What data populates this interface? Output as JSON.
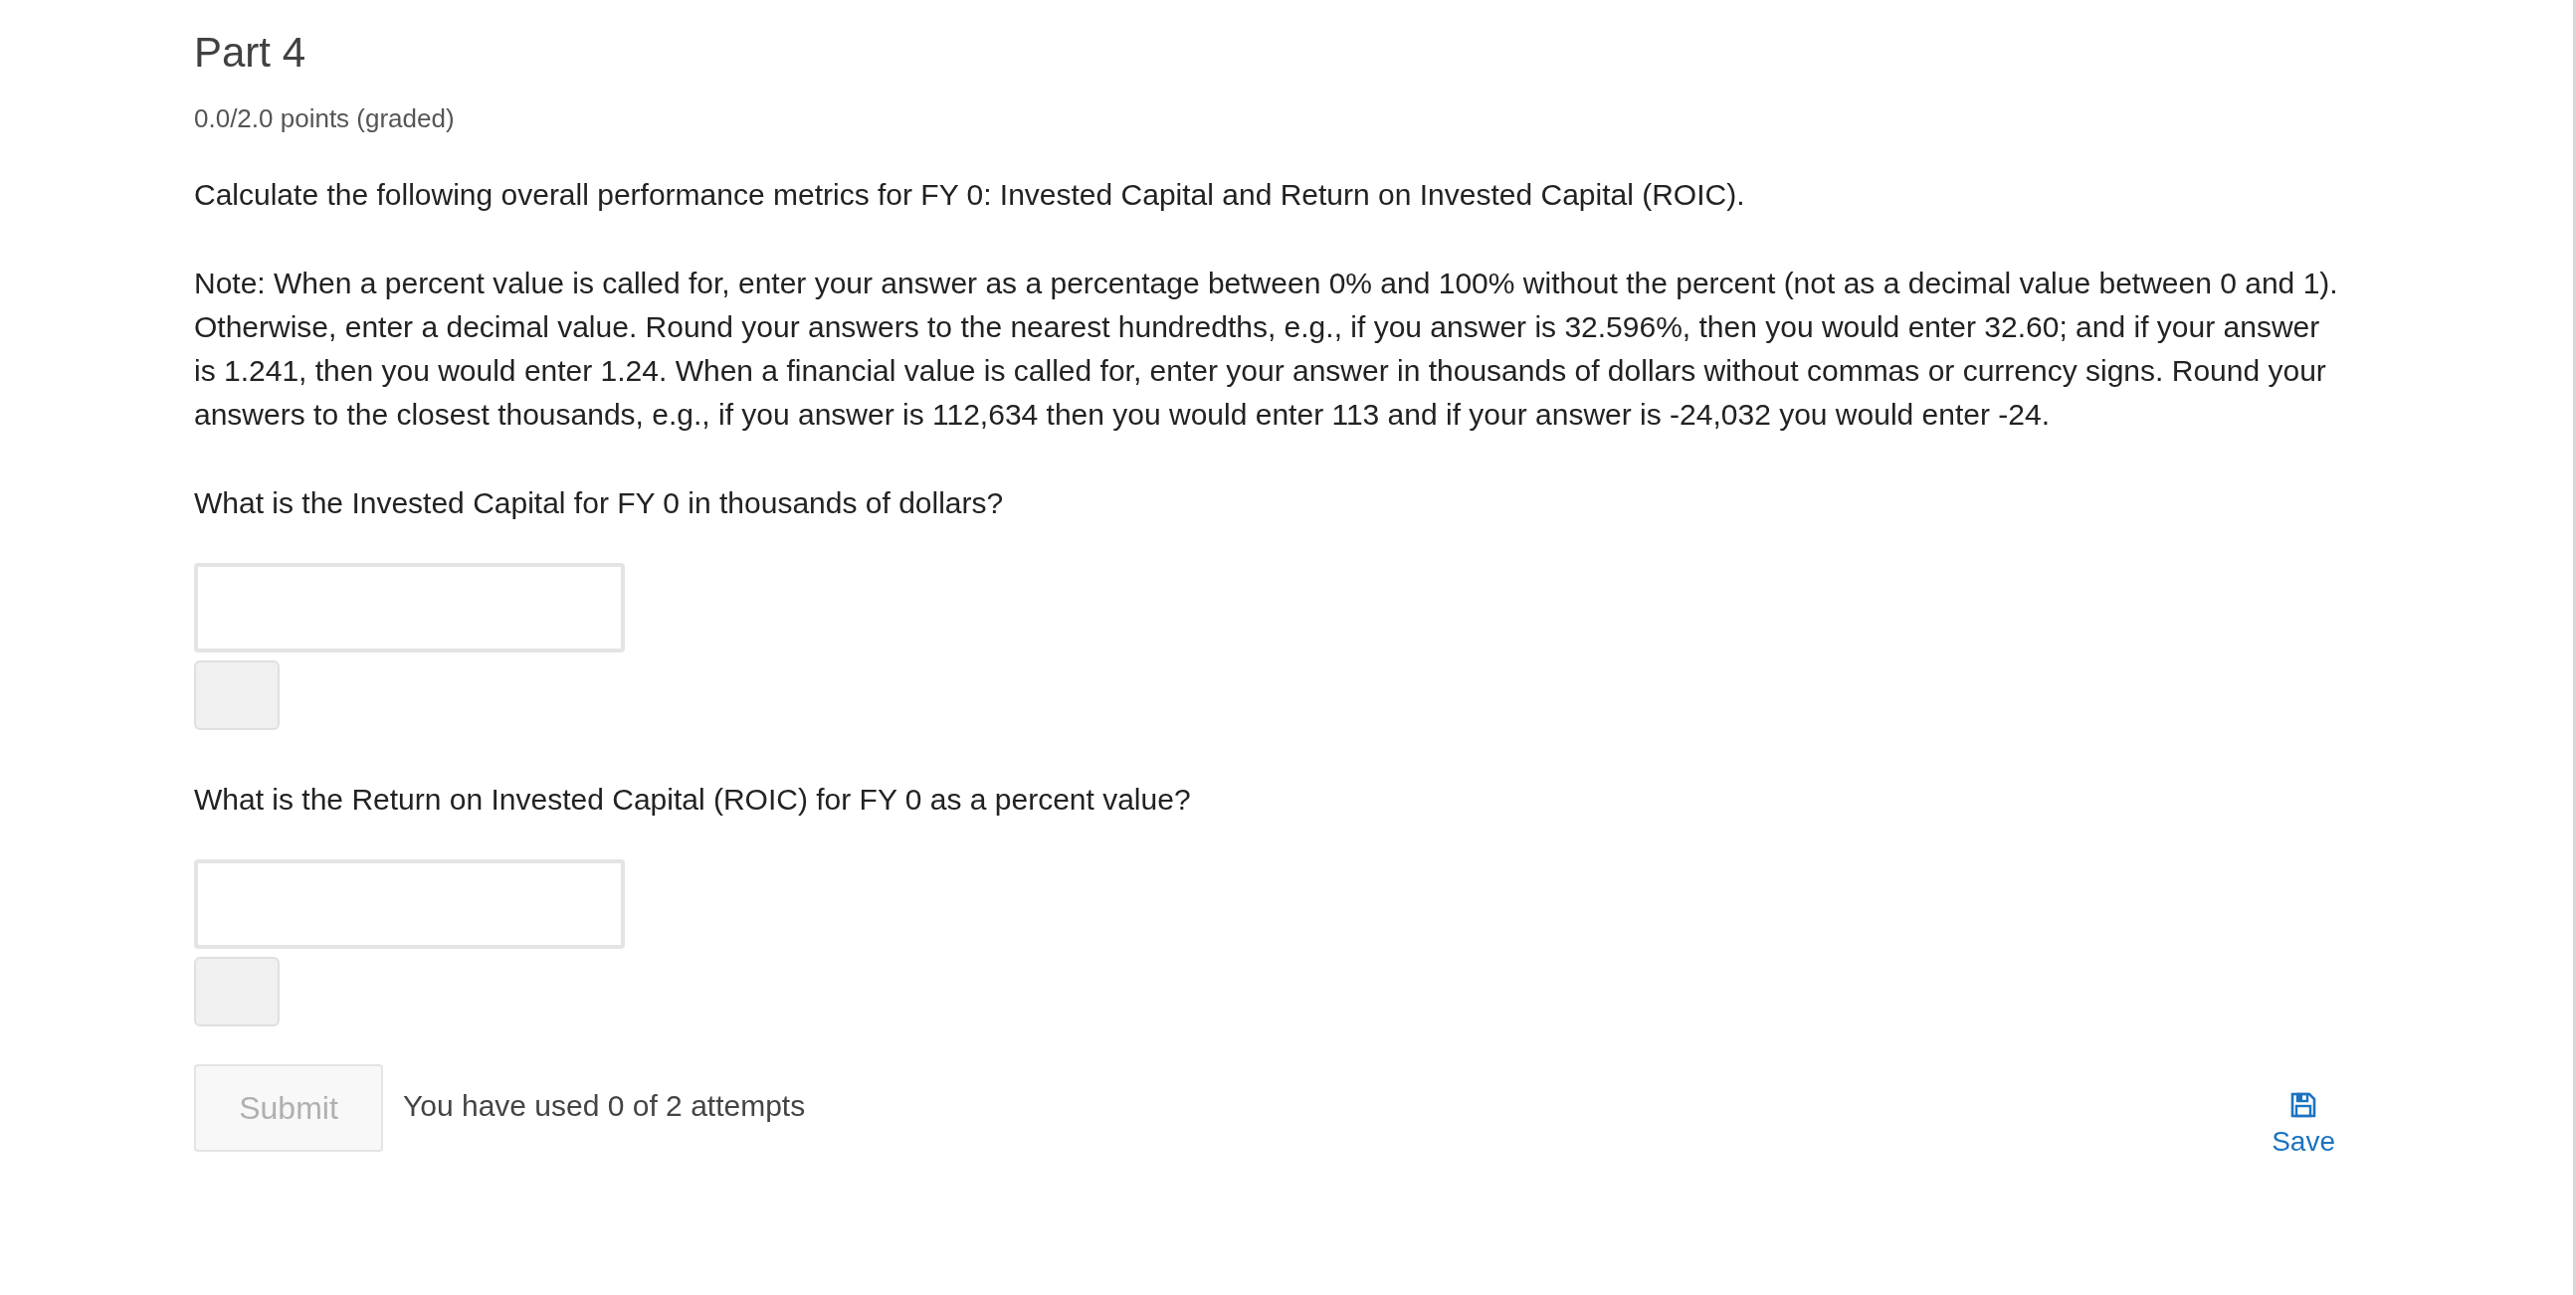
{
  "title": "Part 4",
  "points": "0.0/2.0 points (graded)",
  "intro": "Calculate the following overall performance metrics for FY 0: Invested Capital and Return on Invested Capital (ROIC).",
  "note": "Note: When a percent value is called for, enter your answer as a percentage between 0% and 100% without the percent (not as a decimal value between 0 and 1). Otherwise, enter a decimal value. Round your answers to the nearest hundredths, e.g., if you answer is 32.596%, then you would enter 32.60; and if your answer is 1.241, then you would enter 1.24. When a financial value is called for, enter your answer in thousands of dollars without commas or currency signs. Round your answers to the closest thousands, e.g., if you answer is 112,634 then you would enter 113 and if your answer is -24,032 you would enter -24.",
  "questions": [
    {
      "prompt": "What is the Invested Capital for FY 0 in thousands of dollars?"
    },
    {
      "prompt": "What is the Return on Invested Capital (ROIC) for FY 0 as a percent value?"
    }
  ],
  "submit": {
    "label": "Submit",
    "disabled": true
  },
  "attempts": "You have used 0 of 2 attempts",
  "save": {
    "label": "Save"
  }
}
